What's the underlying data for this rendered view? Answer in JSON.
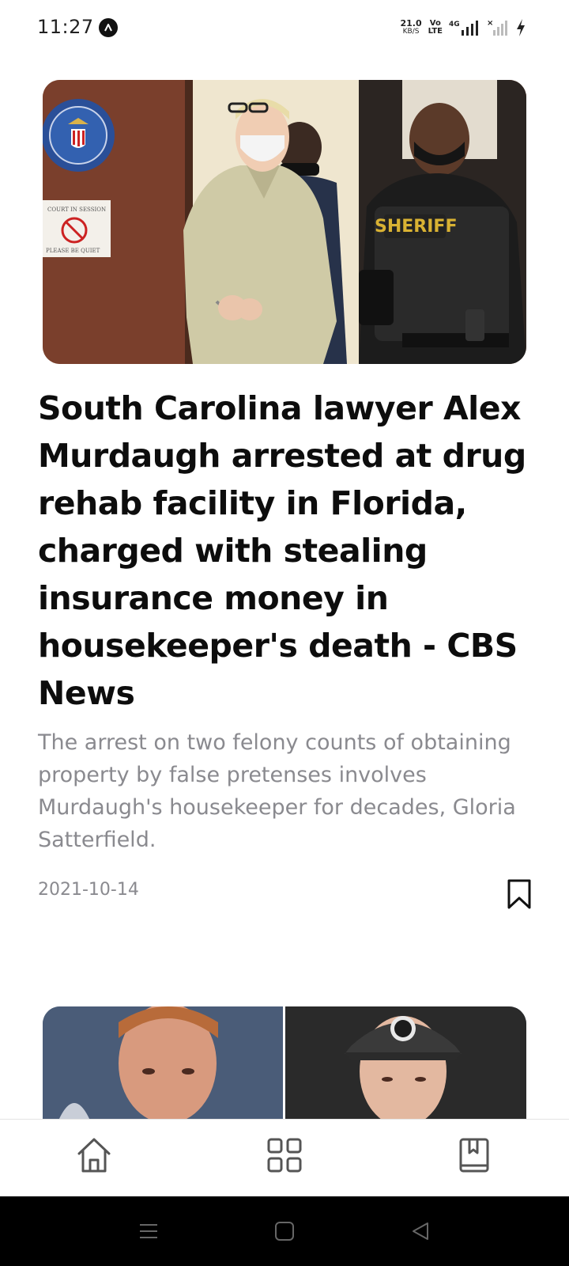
{
  "status_bar": {
    "time": "11:27",
    "net_speed_value": "21.0",
    "net_speed_unit": "KB/S",
    "volte_top": "Vo",
    "volte_bottom": "LTE",
    "network_type": "4G"
  },
  "article": {
    "title": "South Carolina lawyer Alex Murdaugh arrested at drug rehab facility in Florida, charged with stealing insurance money in housekeeper's death - CBS News",
    "summary": "The arrest on two felony counts of obtaining property by false pretenses involves Murdaugh's housekeeper for decades, Gloria Satterfield.",
    "date": "2021-10-14",
    "image_sign_text": "COURT IN SESSION",
    "image_sign_subtext": "PLEASE BE QUIET",
    "image_vest_text": "SHERIFF"
  },
  "bottom_nav": {
    "items": [
      {
        "icon": "home-icon"
      },
      {
        "icon": "grid-icon"
      },
      {
        "icon": "book-icon"
      }
    ]
  },
  "colors": {
    "title": "#0d0d0d",
    "muted": "#8a8a8f",
    "background": "#ffffff",
    "system_nav": "#000000"
  }
}
